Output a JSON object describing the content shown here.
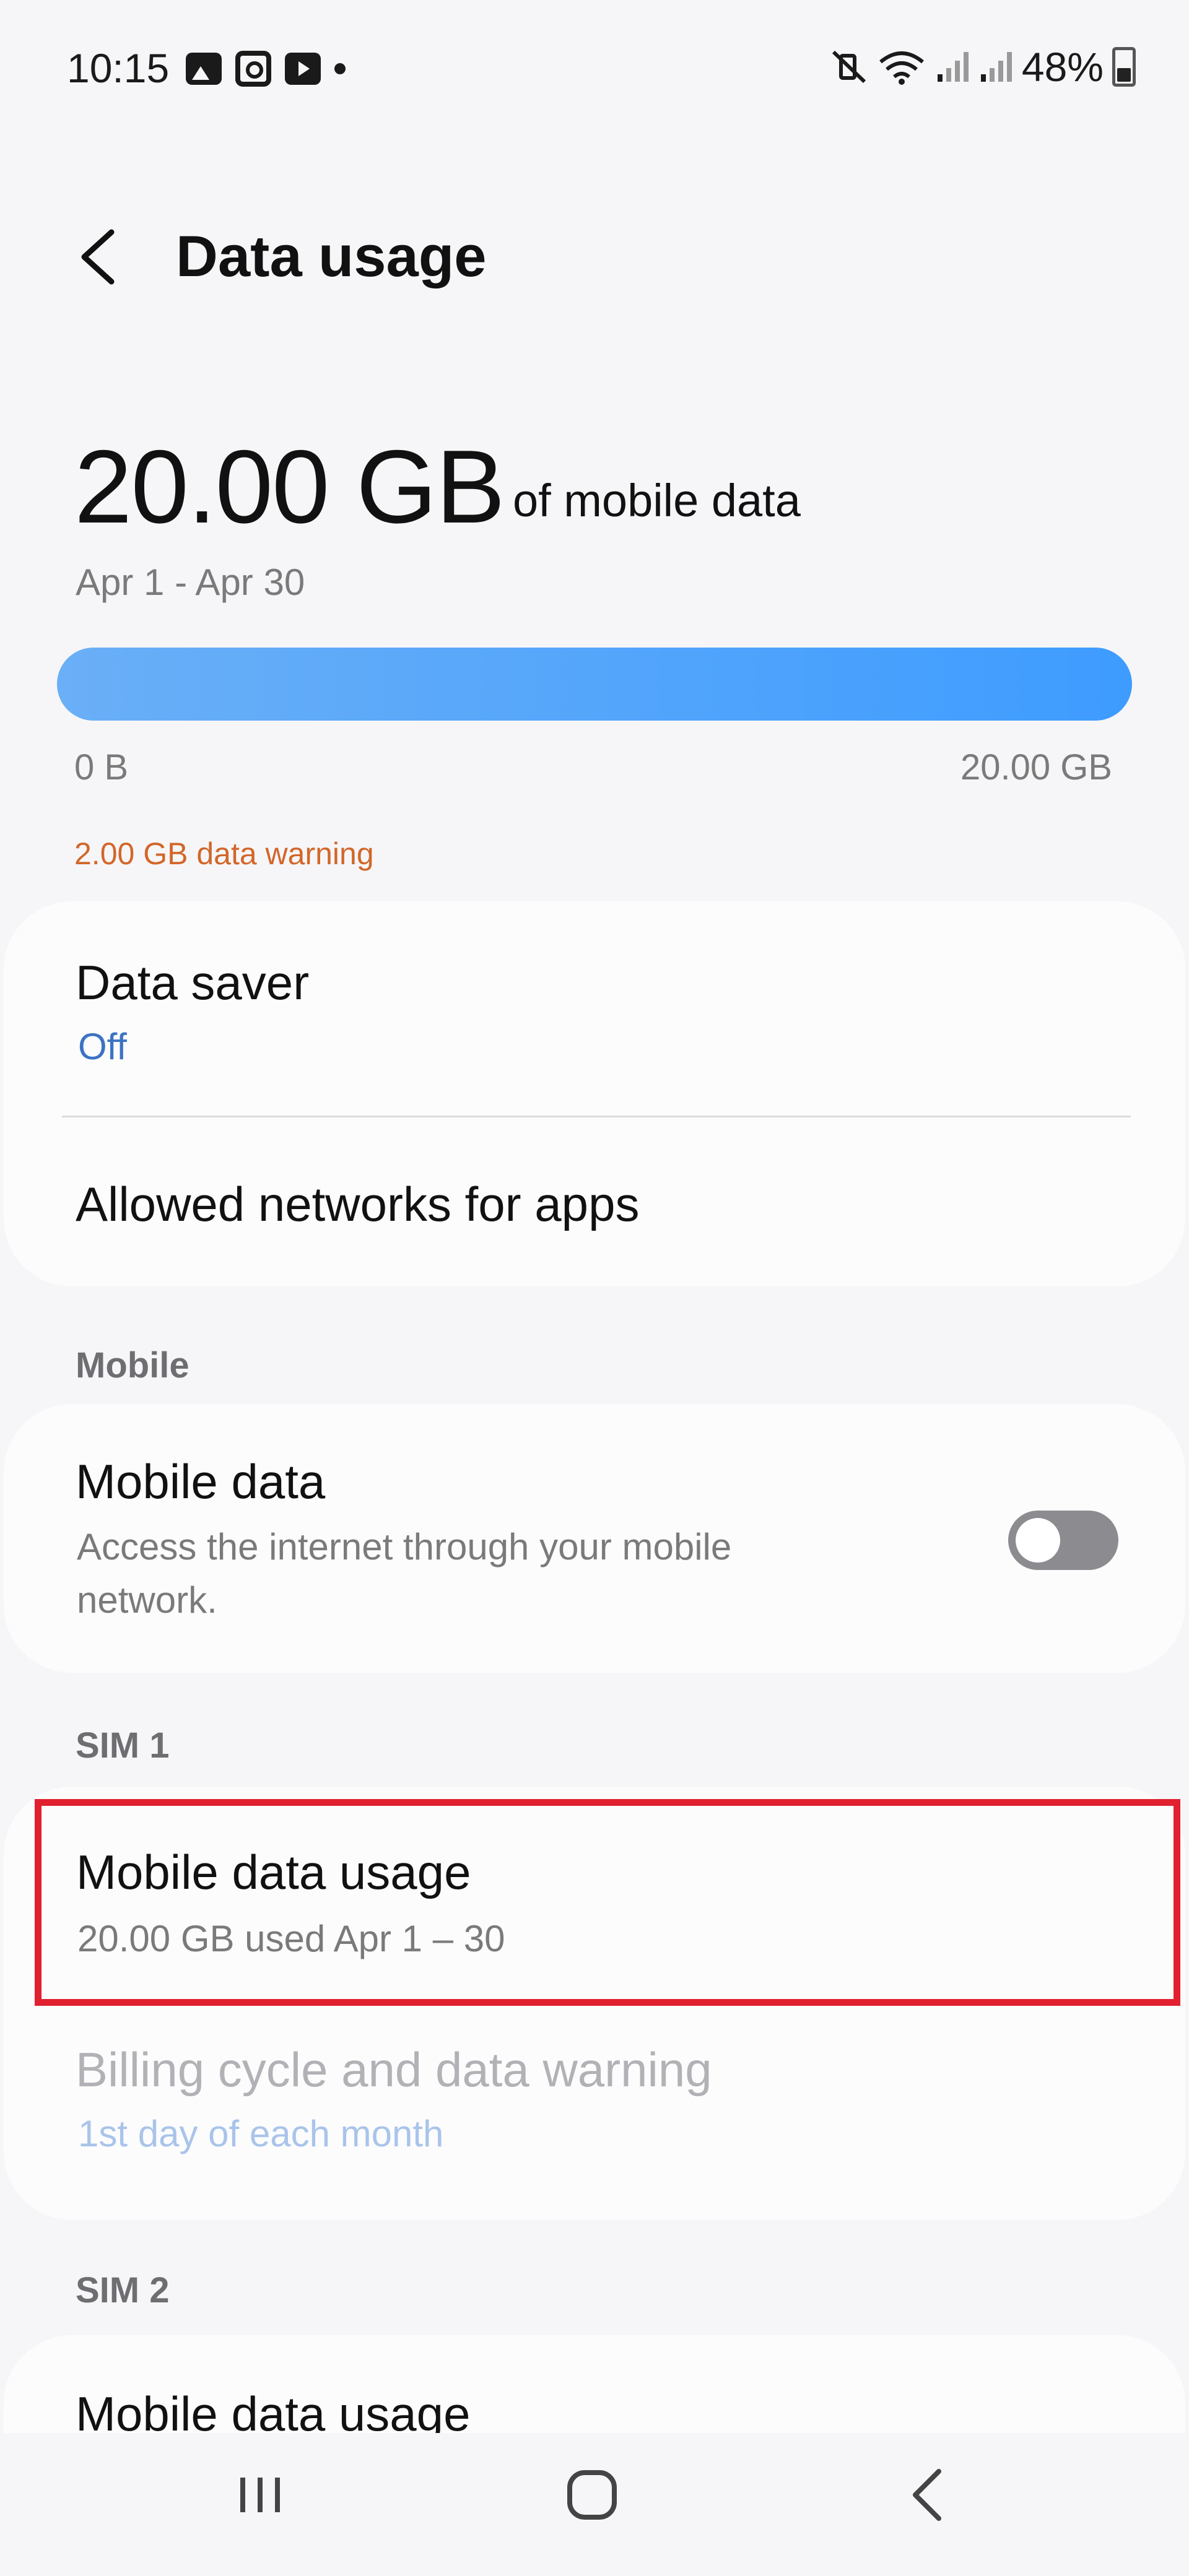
{
  "status_bar": {
    "time": "10:15",
    "battery": "48%",
    "left_icons": [
      "gallery-icon",
      "instagram-icon",
      "youtube-icon",
      "notification-dot-icon"
    ],
    "right_icons": [
      "mute-vibrate-icon",
      "wifi-icon",
      "signal-sim1-icon",
      "signal-sim2-icon",
      "battery-icon"
    ]
  },
  "header": {
    "title": "Data usage",
    "back_icon": "back-chevron-icon"
  },
  "usage": {
    "amount": "20.00 GB",
    "suffix": "of mobile data",
    "period": "Apr 1 - Apr 30",
    "bar_min": "0 B",
    "bar_max": "20.00 GB",
    "warning": "2.00 GB data warning",
    "bar_fill_fraction": 1.0,
    "bar_color": "#3e9cff"
  },
  "card1": {
    "data_saver": {
      "title": "Data saver",
      "value": "Off"
    },
    "allowed_networks": {
      "title": "Allowed networks for apps"
    }
  },
  "mobile_section": {
    "label": "Mobile",
    "mobile_data": {
      "title": "Mobile data",
      "subtitle_line1": "Access the internet through your mobile",
      "subtitle_line2": "network.",
      "toggle_on": false
    }
  },
  "sim1": {
    "label": "SIM 1",
    "mobile_data_usage": {
      "title": "Mobile data usage",
      "subtitle": "20.00 GB used Apr 1 – 30"
    },
    "billing": {
      "title": "Billing cycle and data warning",
      "subtitle": "1st day of each month"
    }
  },
  "sim2": {
    "label": "SIM 2",
    "mobile_data_usage": {
      "title": "Mobile data usage"
    }
  },
  "navbar": {
    "icons": [
      "recents-icon",
      "home-icon",
      "back-icon"
    ]
  },
  "colors": {
    "accent": "#3b73c4",
    "warning": "#d2672a",
    "highlight": "#e12030"
  }
}
